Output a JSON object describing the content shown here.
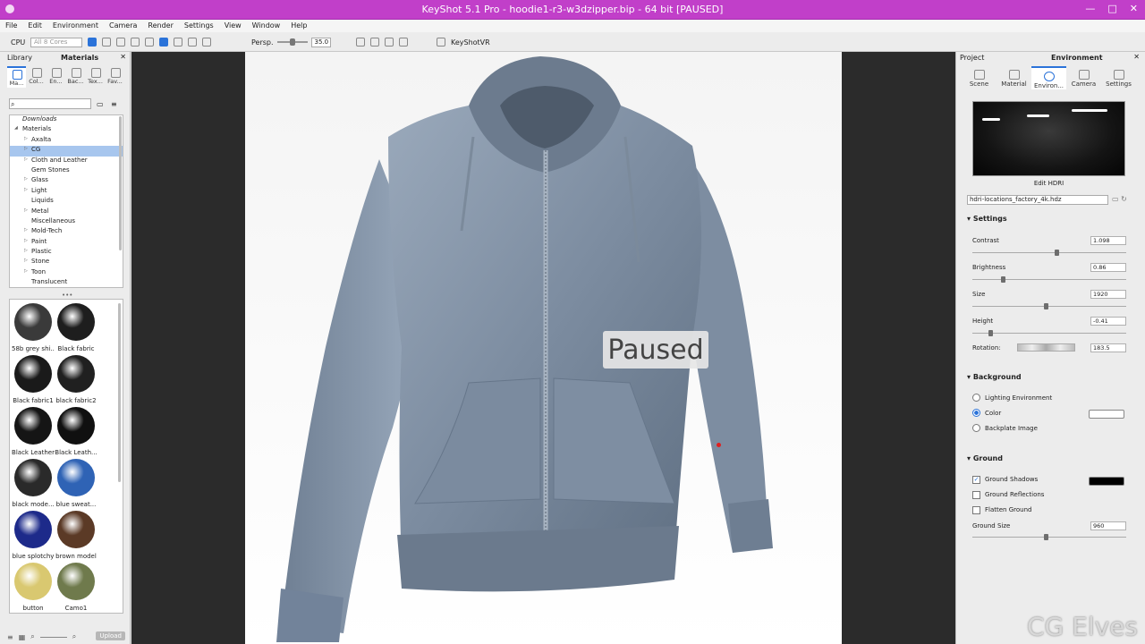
{
  "titlebar": {
    "title": "KeyShot 5.1 Pro  - hoodie1-r3-w3dzipper.bip  - 64 bit [PAUSED]",
    "accent": "#c13fc9",
    "min": "—",
    "max": "□",
    "close": "✕"
  },
  "menu": [
    "File",
    "Edit",
    "Environment",
    "Camera",
    "Render",
    "Settings",
    "View",
    "Window",
    "Help"
  ],
  "toolbar": {
    "cpu_label": "CPU",
    "cores": "All 8 Cores",
    "persp_label": "Persp.",
    "fov_value": "35.0",
    "vr_label": "KeyShotVR"
  },
  "library": {
    "header_left": "Library",
    "header_title": "Materials",
    "tabs": [
      "Ma...",
      "Col...",
      "En...",
      "Bac...",
      "Tex...",
      "Fav..."
    ],
    "search_placeholder": "",
    "downloads": "Downloads",
    "root": "Materials",
    "tree": [
      "Axalta",
      "CG",
      "Cloth and Leather",
      "Gem Stones",
      "Glass",
      "Light",
      "Liquids",
      "Metal",
      "Miscellaneous",
      "Mold-Tech",
      "Paint",
      "Plastic",
      "Stone",
      "Toon",
      "Translucent"
    ],
    "selected_index": 1,
    "thumbs": [
      {
        "name": "58b grey shi...",
        "color": "#3a3a3a"
      },
      {
        "name": "Black fabric",
        "color": "#1e1e1e"
      },
      {
        "name": "Black fabric1",
        "color": "#1a1a1a"
      },
      {
        "name": "black fabric2",
        "color": "#202020"
      },
      {
        "name": "Black Leather",
        "color": "#151515"
      },
      {
        "name": "Black Leath...",
        "color": "#101010"
      },
      {
        "name": "black mode...",
        "color": "#2a2a2a"
      },
      {
        "name": "blue sweat...",
        "color": "#2f63b5"
      },
      {
        "name": "blue splotchy",
        "color": "#1d2a8a"
      },
      {
        "name": "brown model",
        "color": "#5b3a26"
      },
      {
        "name": "button",
        "color": "#d9c870"
      },
      {
        "name": "Camo1",
        "color": "#6f7a4c"
      }
    ],
    "upload_label": "Upload"
  },
  "viewport": {
    "paused_label": "Paused"
  },
  "right": {
    "header_left": "Project",
    "header_title": "Environment",
    "tabs": [
      "Scene",
      "Material",
      "Environ...",
      "Camera",
      "Settings"
    ],
    "edit_hdri": "Edit HDRI",
    "hdri_file": "hdri-locations_factory_4k.hdz",
    "settings_title": "Settings",
    "contrast_label": "Contrast",
    "contrast_value": "1.098",
    "contrast_pos": 0.55,
    "brightness_label": "Brightness",
    "brightness_value": "0.86",
    "brightness_pos": 0.19,
    "size_label": "Size",
    "size_value": "1920",
    "size_pos": 0.48,
    "height_label": "Height",
    "height_value": "-0.41",
    "height_pos": 0.11,
    "rotation_label": "Rotation:",
    "rotation_value": "183.5",
    "background_title": "Background",
    "bg_lighting": "Lighting Environment",
    "bg_color": "Color",
    "bg_color_swatch": "#ffffff",
    "bg_backplate": "Backplate Image",
    "ground_title": "Ground",
    "ground_shadows": "Ground Shadows",
    "ground_shadow_color": "#000000",
    "ground_reflections": "Ground Reflections",
    "flatten_ground": "Flatten Ground",
    "ground_size_label": "Ground Size",
    "ground_size_value": "960",
    "ground_size_pos": 0.48
  },
  "watermark": "CG Elves"
}
